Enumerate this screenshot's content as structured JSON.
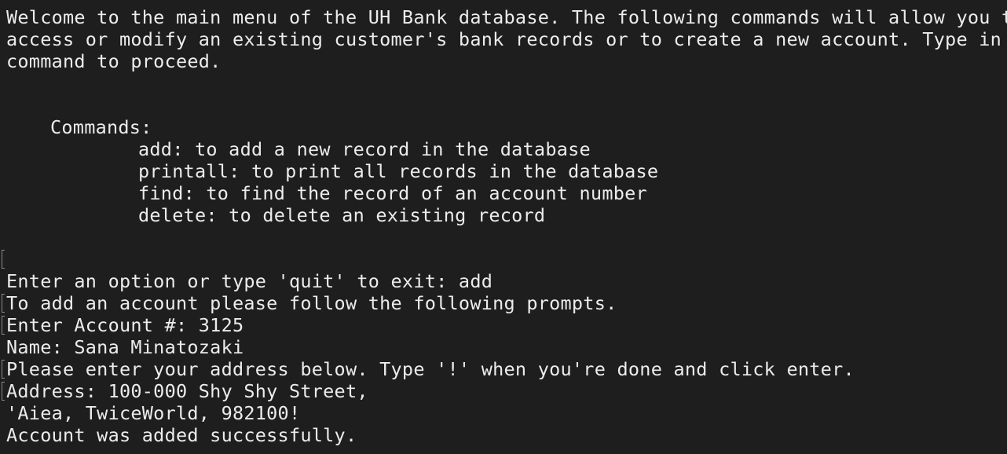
{
  "terminal": {
    "intro": [
      "Welcome to the main menu of the UH Bank database. The following commands will allow you to",
      "access or modify an existing customer's bank records or to create a new account. Type in a",
      "command to proceed."
    ],
    "commands_header": "Commands:",
    "commands": [
      "add: to add a new record in the database",
      "printall: to print all records in the database",
      "find: to find the record of an account number",
      "delete: to delete an existing record"
    ],
    "session": [
      "Enter an option or type 'quit' to exit: add",
      "To add an account please follow the following prompts.",
      "Enter Account #: 3125",
      "Name: Sana Minatozaki",
      "Please enter your address below. Type '!' when you're done and click enter.",
      "Address: 100-000 Shy Shy Street,",
      "'Aiea, TwiceWorld, 982100!",
      "Account was added successfully."
    ]
  }
}
